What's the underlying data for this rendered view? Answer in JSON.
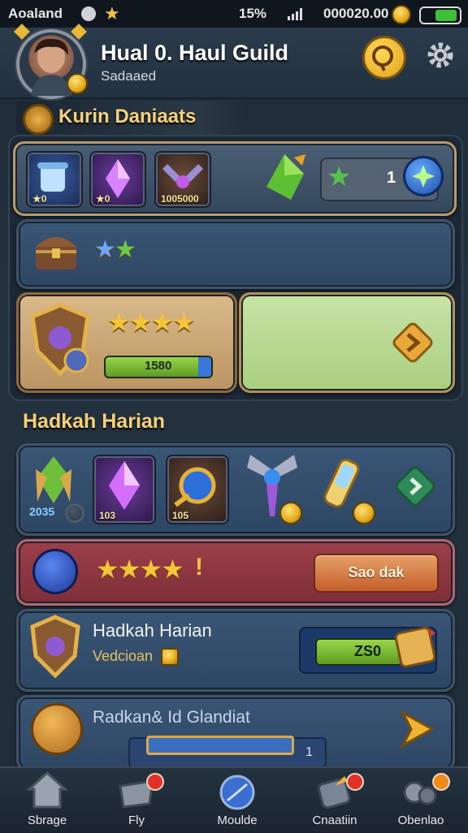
{
  "status": {
    "carrier": "Aoaland",
    "battery_pct": "15%",
    "balance": "000020.00"
  },
  "header": {
    "title": "Hual 0. Haul Guild",
    "subtitle": "Sadaaed"
  },
  "section1": {
    "title": "Kurin Daniaats"
  },
  "row1": {
    "slots": [
      {
        "label": "0"
      },
      {
        "label": "0"
      },
      {
        "label": "1005000"
      }
    ],
    "right_value": "1"
  },
  "row2": {
    "stars": "★★"
  },
  "row3": {
    "stars": "★★★★",
    "bar_value": "1580"
  },
  "section2": {
    "title": "Hadkah Harian"
  },
  "row4": {
    "slots": [
      {
        "label": "2035"
      },
      {
        "label": "103"
      },
      {
        "label": "105"
      }
    ]
  },
  "row5": {
    "stars": "★★★★",
    "button_label": "Sao dak"
  },
  "row6": {
    "title": "Hadkah Harian",
    "subtitle": "Vedcioan",
    "bar_value": "ZS0"
  },
  "row7": {
    "title": "Radkan& Id Glandiat",
    "value": "1"
  },
  "nav": [
    {
      "label": "Sbrage"
    },
    {
      "label": "Fly"
    },
    {
      "label": "Moulde"
    },
    {
      "label": "Cnaatiin"
    },
    {
      "label": "Obenlao"
    }
  ],
  "colors": {
    "accent_gold": "#f5d27a",
    "panel_blue": "#2d4663",
    "panel_red": "#7e2e39",
    "bar_green": "#7cc13a"
  }
}
